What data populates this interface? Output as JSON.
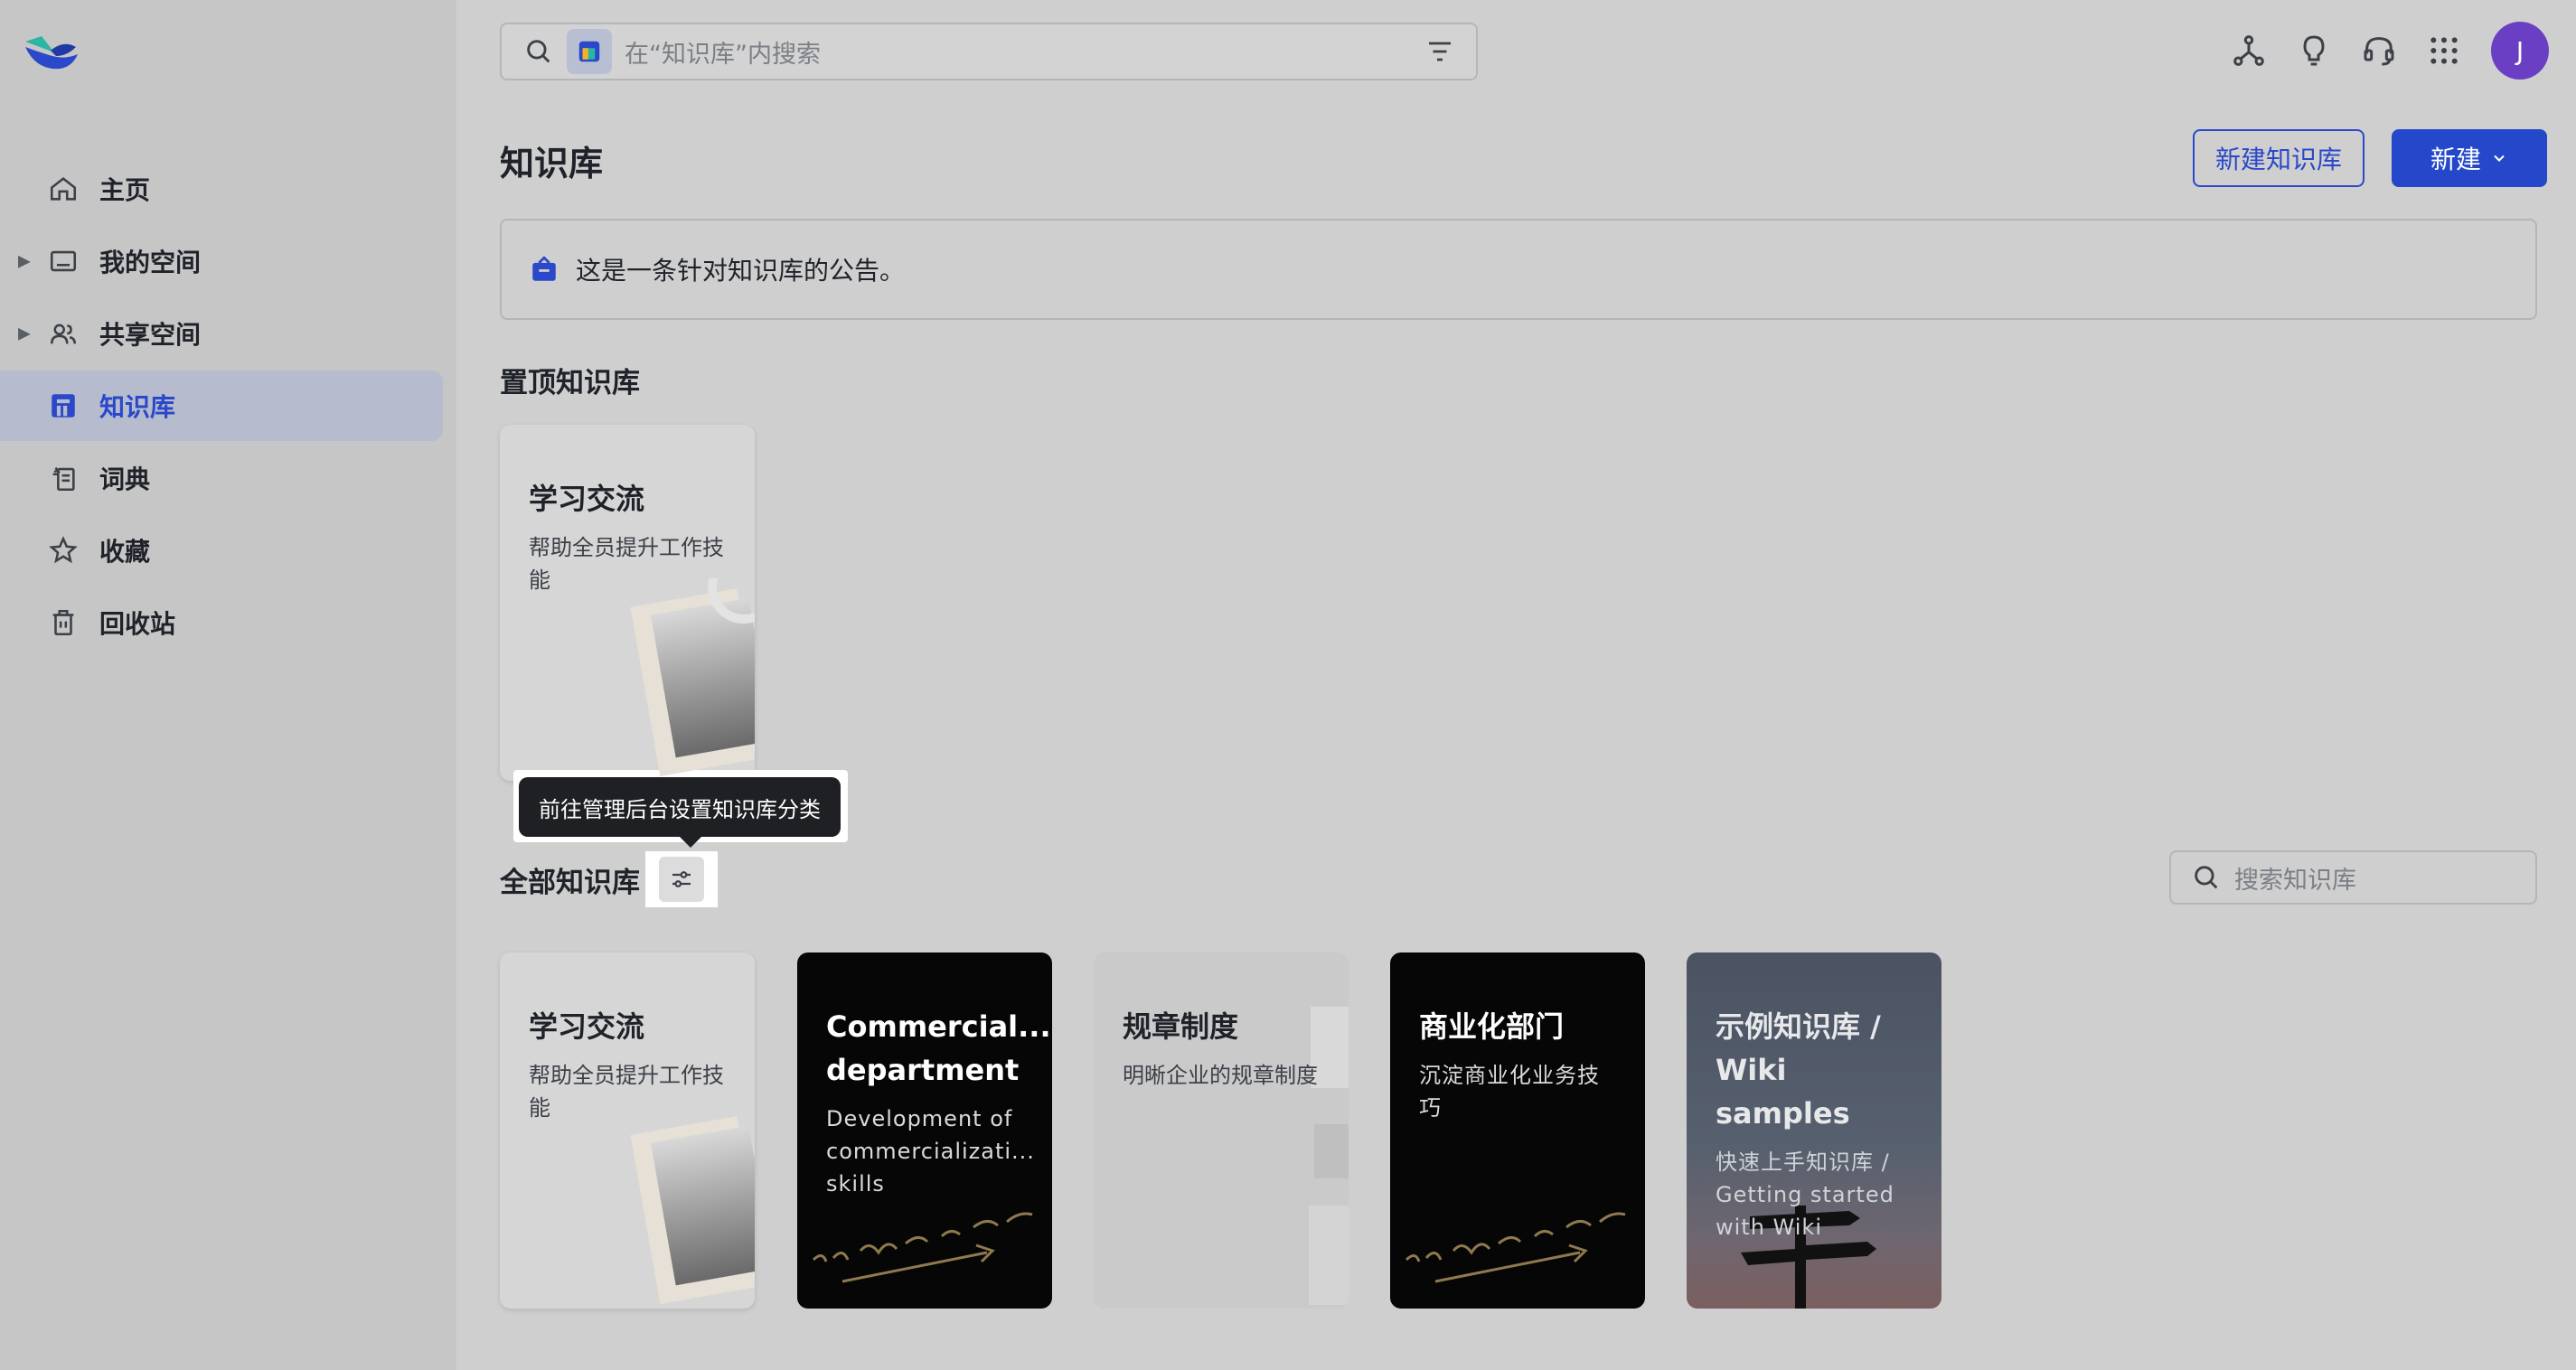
{
  "search": {
    "placeholder": "在“知识库”内搜索"
  },
  "user": {
    "avatar_initial": "J"
  },
  "sidebar": {
    "items": [
      {
        "label": "主页",
        "icon": "home-icon",
        "expandable": false,
        "active": false
      },
      {
        "label": "我的空间",
        "icon": "folder-icon",
        "expandable": true,
        "active": false
      },
      {
        "label": "共享空间",
        "icon": "users-icon",
        "expandable": true,
        "active": false
      },
      {
        "label": "知识库",
        "icon": "wiki-icon",
        "expandable": false,
        "active": true
      },
      {
        "label": "词典",
        "icon": "dictionary-icon",
        "expandable": false,
        "active": false
      },
      {
        "label": "收藏",
        "icon": "star-icon",
        "expandable": false,
        "active": false
      },
      {
        "label": "回收站",
        "icon": "trash-icon",
        "expandable": false,
        "active": false
      }
    ]
  },
  "header": {
    "title": "知识库",
    "new_wiki_label": "新建知识库",
    "new_label": "新建"
  },
  "announcement": {
    "text": "这是一条针对知识库的公告。"
  },
  "pinned": {
    "title": "置顶知识库",
    "cards": [
      {
        "title": "学习交流",
        "desc": "帮助全员提升工作技能"
      }
    ]
  },
  "all": {
    "title": "全部知识库",
    "tooltip": "前往管理后台设置知识库分类",
    "search_placeholder": "搜索知识库",
    "cards": [
      {
        "title": "学习交流",
        "desc": "帮助全员提升工作技能"
      },
      {
        "title": "Commercial... department",
        "desc": "Development of commercializati... skills"
      },
      {
        "title": "规章制度",
        "desc": "明晰企业的规章制度"
      },
      {
        "title": "商业化部门",
        "desc": "沉淀商业化业务技巧"
      },
      {
        "title": "示例知识库 / Wiki samples",
        "desc": "快速上手知识库 / Getting started with Wiki"
      }
    ]
  },
  "colors": {
    "accent": "#2448c9",
    "avatar": "#6b3fc4",
    "background": "#cfcfcf"
  }
}
